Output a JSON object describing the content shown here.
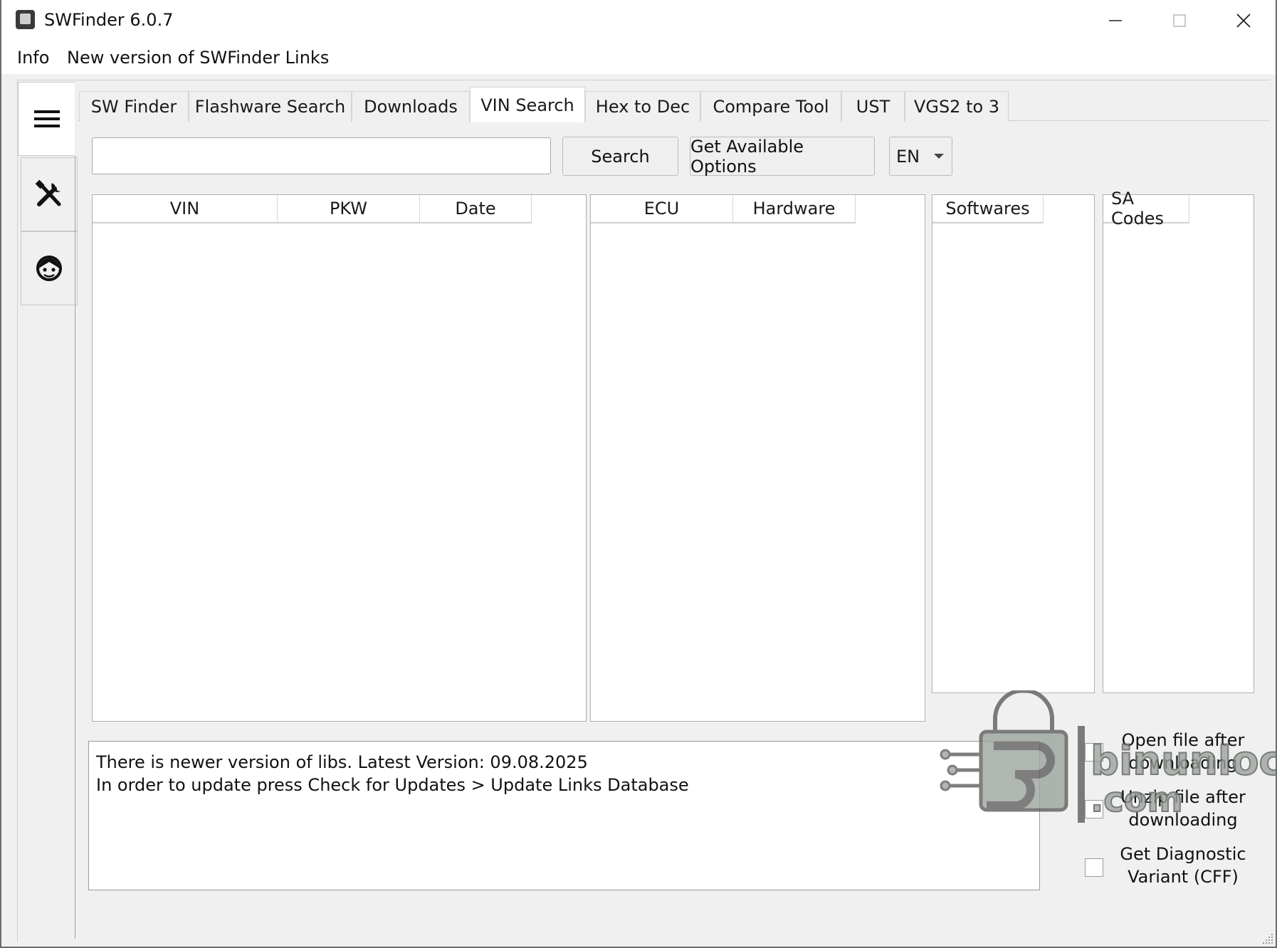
{
  "window": {
    "title": "SWFinder 6.0.7"
  },
  "menu": {
    "items": [
      {
        "label": "Info"
      },
      {
        "label": "New version of SWFinder Links"
      }
    ]
  },
  "sidebar": {
    "items": [
      {
        "icon": "hamburger-menu-icon",
        "active": true
      },
      {
        "icon": "tools-icon",
        "active": false
      },
      {
        "icon": "support-face-icon",
        "active": false
      }
    ]
  },
  "tabs": [
    {
      "label": "SW Finder"
    },
    {
      "label": "Flashware Search"
    },
    {
      "label": "Downloads"
    },
    {
      "label": "VIN Search",
      "active": true
    },
    {
      "label": "Hex to Dec"
    },
    {
      "label": "Compare Tool"
    },
    {
      "label": "UST"
    },
    {
      "label": "VGS2 to 3"
    }
  ],
  "search": {
    "value": "",
    "search_label": "Search",
    "options_label": "Get Available Options",
    "language": "EN"
  },
  "tables": {
    "vehicles": {
      "columns": [
        "VIN",
        "PKW",
        "Date"
      ],
      "rows": []
    },
    "ecus": {
      "columns": [
        "ECU",
        "Hardware"
      ],
      "rows": []
    },
    "softwares": {
      "columns": [
        "Softwares"
      ],
      "rows": []
    },
    "sa_codes": {
      "columns": [
        "SA Codes"
      ],
      "rows": []
    }
  },
  "log": {
    "lines": [
      "There is newer version of libs. Latest Version: 09.08.2025",
      "In order to update press Check for Updates > Update Links Database"
    ]
  },
  "options": {
    "open_file": {
      "line1": "Open file after",
      "line2": "downloading",
      "checked": false
    },
    "unzip_file": {
      "line1": "Unzip file after",
      "line2": "downloading",
      "checked": false
    },
    "diag_variant": {
      "line1": "Get Diagnostic",
      "line2": "Variant (CFF)",
      "checked": false
    }
  },
  "watermark": {
    "text_top": "binunlock",
    "text_bottom": ".com"
  }
}
